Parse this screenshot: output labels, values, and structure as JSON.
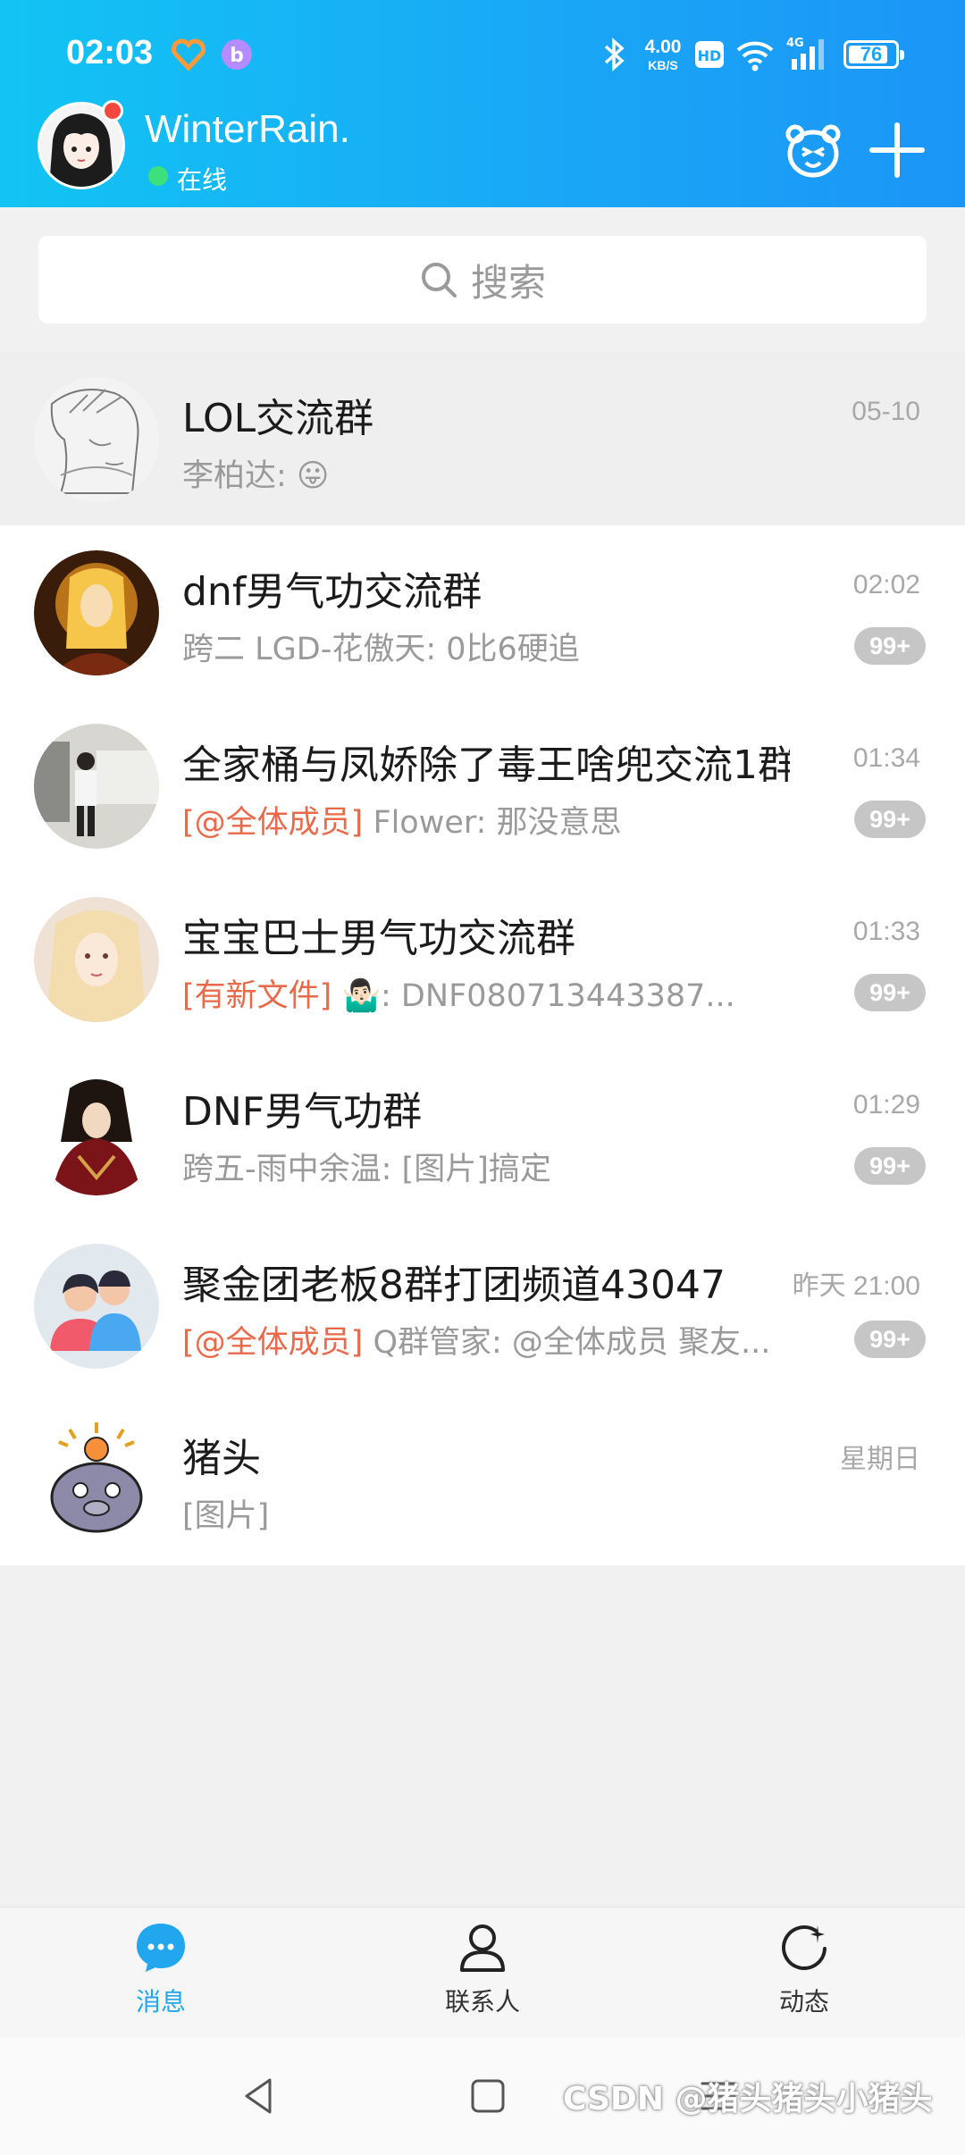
{
  "status_bar": {
    "time": "02:03",
    "net_speed_value": "4.00",
    "net_speed_unit": "KB/S",
    "hd_label": "HD",
    "network_type": "4G",
    "battery_level": "76"
  },
  "profile": {
    "nickname": "WinterRain.",
    "status": "在线"
  },
  "search": {
    "placeholder": "搜索"
  },
  "chats": [
    {
      "name": "LOL交流群",
      "preview_prefix": "",
      "preview": "李柏达: ",
      "preview_emoji": "😛",
      "time": "05-10",
      "badge": "",
      "pinned": true
    },
    {
      "name": "dnf男气功交流群",
      "preview_prefix": "",
      "preview": "跨二 LGD-花傲天: 0比6硬追",
      "preview_emoji": "",
      "time": "02:02",
      "badge": "99+",
      "pinned": false
    },
    {
      "name": "全家桶与凤娇除了毒王啥兜交流1群",
      "preview_prefix": "[@全体成员]",
      "preview": " Flower: 那没意思",
      "preview_emoji": "",
      "time": "01:34",
      "badge": "99+",
      "pinned": false
    },
    {
      "name": "宝宝巴士男气功交流群",
      "preview_prefix": "[有新文件]",
      "preview": " 🤷🏻‍♂️: DNF080713443387...",
      "preview_emoji": "",
      "time": "01:33",
      "badge": "99+",
      "pinned": false
    },
    {
      "name": "DNF男气功群",
      "preview_prefix": "",
      "preview": "跨五-雨中余温: [图片]搞定",
      "preview_emoji": "",
      "time": "01:29",
      "badge": "99+",
      "pinned": false
    },
    {
      "name": "聚金团老板8群打团频道43047",
      "preview_prefix": "[@全体成员]",
      "preview": " Q群管家: @全体成员 聚友...",
      "preview_emoji": "",
      "time": "昨天 21:00",
      "badge": "99+",
      "pinned": false
    },
    {
      "name": "猪头",
      "preview_prefix": "",
      "preview": "[图片]",
      "preview_emoji": "",
      "time": "星期日",
      "badge": "",
      "pinned": false
    }
  ],
  "tabs": [
    {
      "label": "消息",
      "active": true
    },
    {
      "label": "联系人",
      "active": false
    },
    {
      "label": "动态",
      "active": false
    }
  ],
  "watermark": "CSDN @猪头猪头小猪头",
  "colors": {
    "header_start": "#12c4f3",
    "header_end": "#1b96f7",
    "accent": "#22a6ee",
    "badge": "#c6c6c6",
    "mention_tag": "#e86a4a",
    "online": "#3ee07a"
  }
}
